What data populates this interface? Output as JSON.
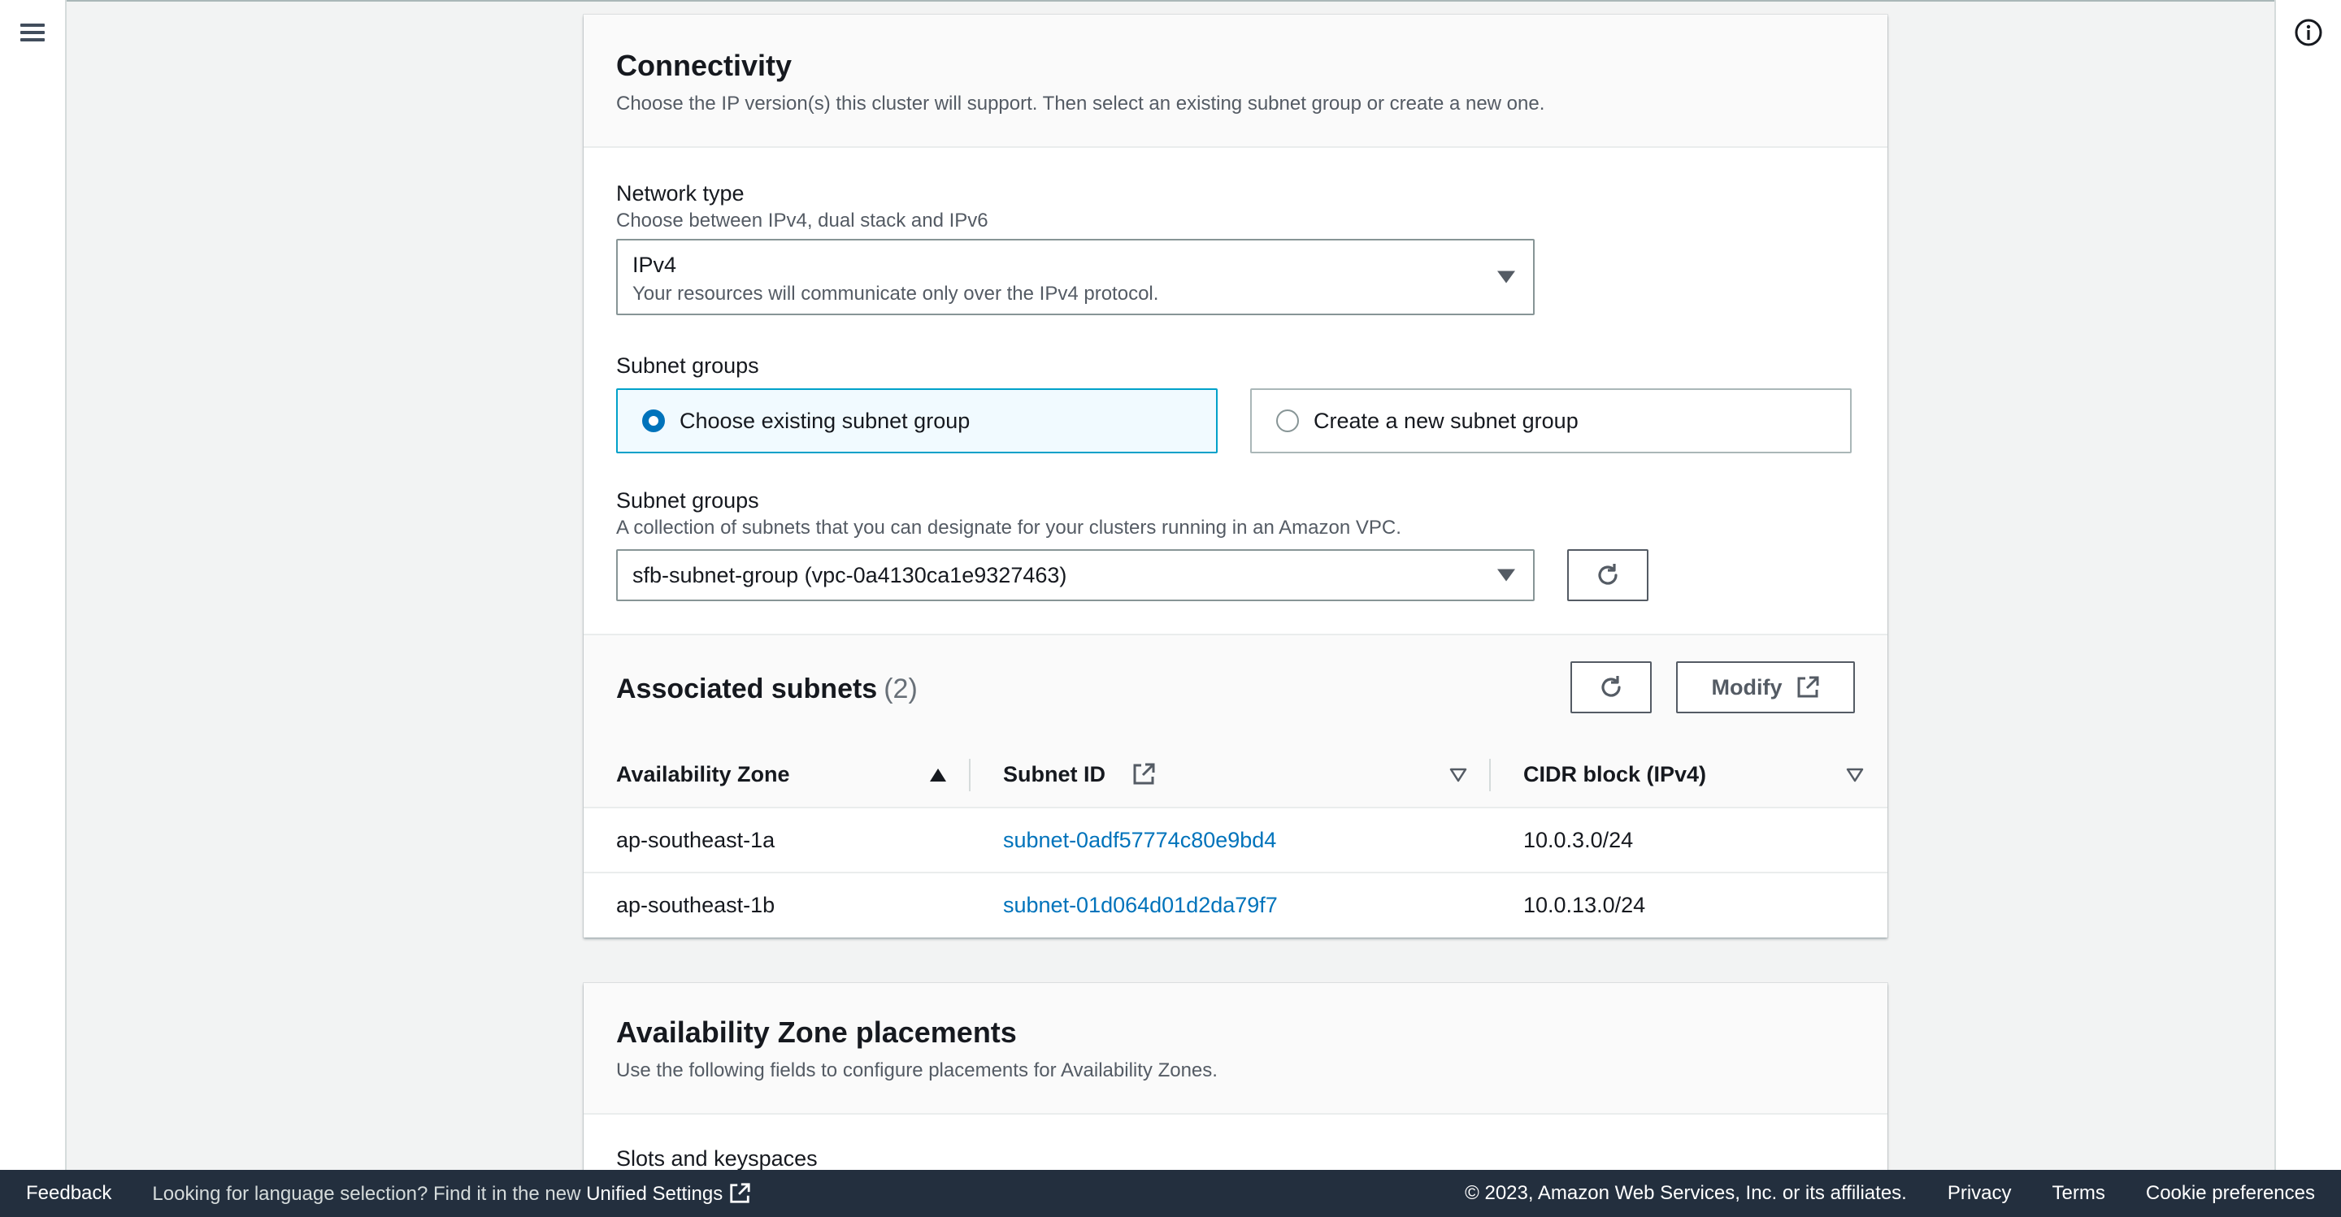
{
  "connectivity": {
    "title": "Connectivity",
    "description": "Choose the IP version(s) this cluster will support. Then select an existing subnet group or create a new one.",
    "network_type": {
      "label": "Network type",
      "sublabel": "Choose between IPv4, dual stack and IPv6",
      "value": "IPv4",
      "value_description": "Your resources will communicate only over the IPv4 protocol."
    },
    "subnet_groups_choice": {
      "label": "Subnet groups",
      "options": [
        {
          "label": "Choose existing subnet group",
          "selected": true
        },
        {
          "label": "Create a new subnet group",
          "selected": false
        }
      ]
    },
    "subnet_group_select": {
      "label": "Subnet groups",
      "sublabel": "A collection of subnets that you can designate for your clusters running in an Amazon VPC.",
      "value": "sfb-subnet-group (vpc-0a4130ca1e9327463)"
    },
    "associated_subnets": {
      "title": "Associated subnets",
      "count": "(2)",
      "modify_label": "Modify",
      "columns": [
        "Availability Zone",
        "Subnet ID",
        "CIDR block (IPv4)"
      ],
      "rows": [
        {
          "az": "ap-southeast-1a",
          "subnet_id": "subnet-0adf57774c80e9bd4",
          "cidr": "10.0.3.0/24"
        },
        {
          "az": "ap-southeast-1b",
          "subnet_id": "subnet-01d064d01d2da79f7",
          "cidr": "10.0.13.0/24"
        }
      ]
    }
  },
  "az_placements": {
    "title": "Availability Zone placements",
    "description": "Use the following fields to configure placements for Availability Zones.",
    "next_label": "Slots and keyspaces"
  },
  "footer": {
    "feedback": "Feedback",
    "language_prompt": "Looking for language selection? Find it in the new",
    "unified_settings": "Unified Settings",
    "copyright": "© 2023, Amazon Web Services, Inc. or its affiliates.",
    "privacy": "Privacy",
    "terms": "Terms",
    "cookie_preferences": "Cookie preferences"
  },
  "icons": {
    "menu": "hamburger-menu-icon",
    "info": "info-icon",
    "refresh": "refresh-icon",
    "external": "external-link-icon",
    "sort_asc": "sort-ascending-icon",
    "sort": "sort-icon",
    "dropdown": "caret-down-icon"
  },
  "colors": {
    "link": "#0073bb",
    "selected_tile_bg": "#f1faff",
    "footer_bg": "#232f3e"
  }
}
